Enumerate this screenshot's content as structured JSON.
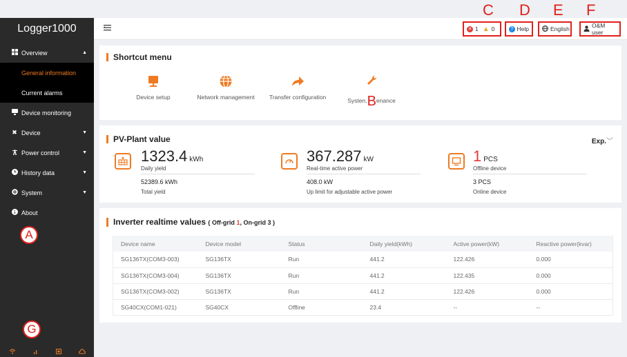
{
  "annotations": {
    "a": "A",
    "b": "B",
    "c": "C",
    "d": "D",
    "e": "E",
    "f": "F",
    "g": "G"
  },
  "sidebar": {
    "logo": "Logger1000",
    "overview": {
      "label": "Overview",
      "icon": "grid-icon"
    },
    "sub_items": [
      {
        "label": "General information",
        "active": true
      },
      {
        "label": "Current alarms",
        "active": false
      }
    ],
    "items": [
      {
        "label": "Device monitoring",
        "icon": "monitor-icon",
        "caret": false
      },
      {
        "label": "Device",
        "icon": "wrench-cross-icon",
        "caret": true
      },
      {
        "label": "Power control",
        "icon": "power-tower-icon",
        "caret": true
      },
      {
        "label": "History data",
        "icon": "clock-icon",
        "caret": true
      },
      {
        "label": "System",
        "icon": "gear-icon",
        "caret": true
      },
      {
        "label": "About",
        "icon": "info-icon",
        "caret": false
      }
    ],
    "bottom_icons": [
      "wifi-icon",
      "signal-icon",
      "storage-icon",
      "cloud-icon"
    ]
  },
  "header": {
    "menu_icon": "menu-toggle-icon",
    "fault_count": "1",
    "alarm_count": "0",
    "help_label": "Help",
    "language_label": "English",
    "user_label": "O&M user",
    "colors": {
      "fault": "#e53935",
      "alarm": "#f5a623",
      "help": "#1e88e5",
      "annotation": "#e0201b"
    }
  },
  "shortcut": {
    "title": "Shortcut menu",
    "items": [
      {
        "label": "Device setup",
        "icon": "device-setup-icon"
      },
      {
        "label": "Network management",
        "icon": "globe-icon"
      },
      {
        "label": "Transfer configuration",
        "icon": "arrow-forward-icon"
      },
      {
        "label": "Systen.",
        "label_tail": "enance",
        "icon": "wrench-icon"
      }
    ]
  },
  "pv_plant": {
    "title": "PV-Plant value",
    "export_label": "Exp.",
    "stats": [
      {
        "value": "1323.4",
        "unit": "kWh",
        "label": "Daily yield",
        "sub_value": "52389.6 kWh",
        "sub_label": "Total yield",
        "icon": "solar-panel-icon"
      },
      {
        "value": "367.287",
        "unit": "kW",
        "label": "Real-time active power",
        "sub_value": "408.0 kW",
        "sub_label": "Up limit for adjustable active power",
        "icon": "gauge-icon"
      },
      {
        "value": "1",
        "unit": "PCS",
        "label": "Offline device",
        "sub_value": "3 PCS",
        "sub_label": "Online device",
        "icon": "screen-icon"
      }
    ]
  },
  "inverter": {
    "title": "Inverter realtime values",
    "paren_open": "(",
    "offgrid_label": "Off-grid",
    "offgrid_count": "1",
    "separator": ",",
    "ongrid_label": "On-grid",
    "ongrid_count": "3",
    "paren_close": ")",
    "columns": [
      "Device name",
      "Device model",
      "Status",
      "Daily yield(kWh)",
      "Active power(kW)",
      "Reactive power(kvar)"
    ],
    "rows": [
      [
        "SG136TX(COM3-003)",
        "SG136TX",
        "Run",
        "441.2",
        "122.426",
        "0.000"
      ],
      [
        "SG136TX(COM3-004)",
        "SG136TX",
        "Run",
        "441.2",
        "122.435",
        "0.000"
      ],
      [
        "SG136TX(COM3-002)",
        "SG136TX",
        "Run",
        "441.2",
        "122.426",
        "0.000"
      ],
      [
        "SG40CX(COM1-021)",
        "SG40CX",
        "Offline",
        "23.4",
        "--",
        "--"
      ]
    ]
  },
  "theme": {
    "accent": "#ef7a22",
    "sidebar_bg": "#2a2a2a",
    "sidebar_sub_bg": "#000000",
    "page_bg": "#eef0f3"
  }
}
